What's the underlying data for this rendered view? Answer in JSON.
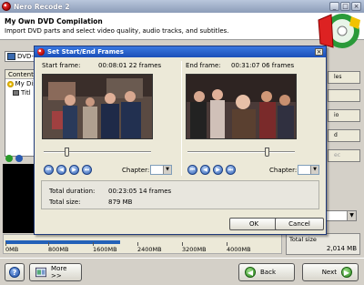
{
  "window": {
    "title": "Nero Recode 2",
    "controls": [
      "_",
      "□",
      "×"
    ]
  },
  "header": {
    "title": "My Own DVD Compilation",
    "subtitle": "Import DVD parts and select video quality, audio tracks, and subtitles."
  },
  "left_panel": {
    "source_combo": "DVD-",
    "tree_header": "Content",
    "tree_items": [
      "My Dis",
      "Titl"
    ]
  },
  "right_panel": {
    "button_fragments": [
      "les",
      "",
      "io",
      "d",
      "ec"
    ],
    "total_size_label": "Total size",
    "total_size_value": "2,014 MB"
  },
  "capacity": {
    "fill_fraction": 0.42,
    "ticks": [
      "0MB",
      "800MB",
      "1600MB",
      "2400MB",
      "3200MB",
      "4000MB"
    ]
  },
  "bottom": {
    "help_label": "?",
    "more_label": "More >>",
    "back_label": "Back",
    "next_label": "Next"
  },
  "dialog": {
    "title": "Set Start/End Frames",
    "start": {
      "label": "Start frame:",
      "value": "00:08:01 22 frames",
      "slider_fraction": 0.2
    },
    "end": {
      "label": "End frame:",
      "value": "00:31:07 06 frames",
      "slider_fraction": 0.75
    },
    "chapter_label": "Chapter:",
    "nav_buttons": [
      "⏮",
      "◀",
      "▶",
      "⏭"
    ],
    "info": {
      "duration_label": "Total duration:",
      "duration_value": "00:23:05 14 frames",
      "size_label": "Total size:",
      "size_value": "879 MB"
    },
    "ok_label": "OK",
    "cancel_label": "Cancel"
  },
  "colors": {
    "dialog_title": "#1a4fb8",
    "capacity_fill": "#2461b8"
  }
}
